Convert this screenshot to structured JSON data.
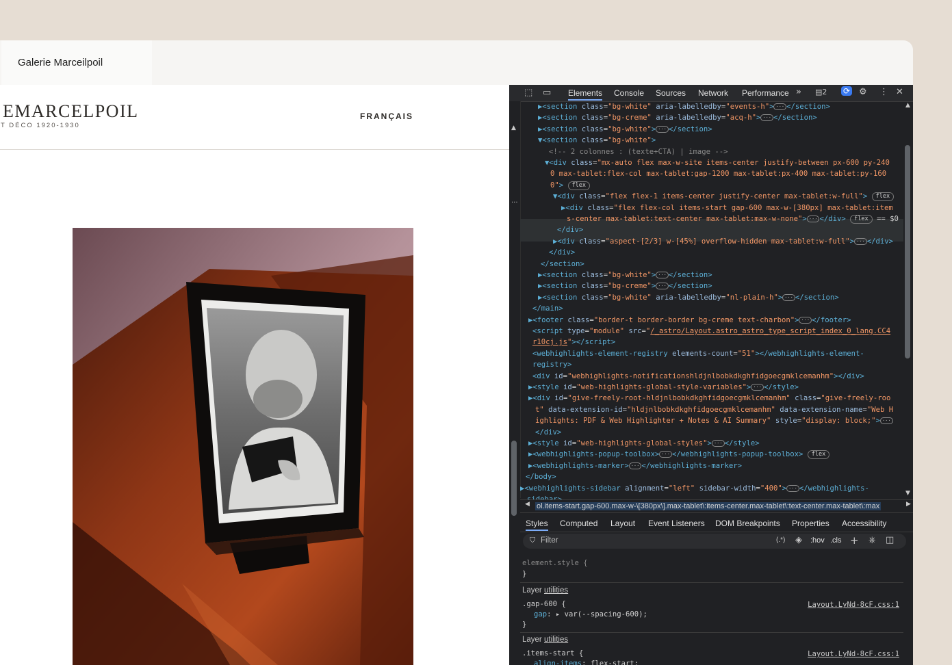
{
  "browser": {
    "tab_title": "Galerie Marceilpoil"
  },
  "site": {
    "logo_text": "EMARCELPOIL",
    "tagline": "T DÉCO 1920-1930",
    "language": "FRANÇAIS"
  },
  "devtools": {
    "tabs": [
      "Elements",
      "Console",
      "Sources",
      "Network",
      "Performance"
    ],
    "issues_count": "2",
    "code_lines": [
      {
        "html": "<span class='tag'>▶&lt;section</span> <span class='attr'>class</span>=<span class='val'>\"bg-white\"</span> <span class='attr'>aria-labelledby</span>=<span class='val'>\"events-h\"</span><span class='tag'>&gt;</span><span class='ell'>···</span><span class='tag'>&lt;/section&gt;</span>",
        "indent": 42
      },
      {
        "html": "<span class='tag'>▶&lt;section</span> <span class='attr'>class</span>=<span class='val'>\"bg-creme\"</span> <span class='attr'>aria-labelledby</span>=<span class='val'>\"acq-h\"</span><span class='tag'>&gt;</span><span class='ell'>···</span><span class='tag'>&lt;/section&gt;</span>",
        "indent": 42
      },
      {
        "html": "<span class='tag'>▶&lt;section</span> <span class='attr'>class</span>=<span class='val'>\"bg-white\"</span><span class='tag'>&gt;</span><span class='ell'>···</span><span class='tag'>&lt;/section&gt;</span>",
        "indent": 42
      },
      {
        "html": "<span class='tag'>▼&lt;section</span> <span class='attr'>class</span>=<span class='val'>\"bg-white\"</span><span class='tag'>&gt;</span>",
        "indent": 42
      },
      {
        "html": "<span class='cmt'>&lt;!-- 2 colonnes : (texte+CTA) | image --&gt;</span>",
        "indent": 58
      },
      {
        "html": "<span class='tag'>▼&lt;div</span> <span class='attr'>class</span>=<span class='val'>\"mx-auto flex max-w-site items-center justify-between px-600 py-240</span>",
        "indent": 52
      },
      {
        "html": "<span class='val'>0 max-tablet:flex-col max-tablet:gap-1200 max-tablet:px-400 max-tablet:py-160</span>",
        "indent": 60
      },
      {
        "html": "<span class='val'>0\"</span><span class='tag'>&gt;</span> <span class='pill'>flex</span>",
        "indent": 60
      },
      {
        "html": "<span class='tag'>▼&lt;div</span> <span class='attr'>class</span>=<span class='val'>\"flex flex-1 items-center justify-center max-tablet:w-full\"</span><span class='tag'>&gt;</span> <span class='pill'>flex</span>",
        "indent": 64
      },
      {
        "html": "<span class='tag'>▶&lt;div</span> <span class='attr'>class</span>=<span class='val'>\"flex flex-col items-start gap-600 max-w-[380px] max-tablet:item</span>",
        "indent": 76
      },
      {
        "html": "<span class='val'>s-center max-tablet:text-center max-tablet:max-w-none\"</span><span class='tag'>&gt;</span><span class='ell'>···</span><span class='tag'>&lt;/div&gt;</span> <span class='pill'>flex</span> <span class='txt'>== $0</span>",
        "indent": 84
      },
      {
        "html": "<span class='tag'>&lt;/div&gt;</span>",
        "indent": 70
      },
      {
        "html": "<span class='tag'>▶&lt;div</span> <span class='attr'>class</span>=<span class='val'>\"aspect-[2/3] w-[45%] overflow-hidden max-tablet:w-full\"</span><span class='tag'>&gt;</span><span class='ell'>···</span><span class='tag'>&lt;/div&gt;</span>",
        "indent": 64
      },
      {
        "html": "<span class='tag'>&lt;/div&gt;</span>",
        "indent": 58
      },
      {
        "html": "<span class='tag'>&lt;/section&gt;</span>",
        "indent": 46
      },
      {
        "html": "<span class='tag'>▶&lt;section</span> <span class='attr'>class</span>=<span class='val'>\"bg-white\"</span><span class='tag'>&gt;</span><span class='ell'>···</span><span class='tag'>&lt;/section&gt;</span>",
        "indent": 42
      },
      {
        "html": "<span class='tag'>▶&lt;section</span> <span class='attr'>class</span>=<span class='val'>\"bg-creme\"</span><span class='tag'>&gt;</span><span class='ell'>···</span><span class='tag'>&lt;/section&gt;</span>",
        "indent": 42
      },
      {
        "html": "<span class='tag'>▶&lt;section</span> <span class='attr'>class</span>=<span class='val'>\"bg-white\"</span> <span class='attr'>aria-labelledby</span>=<span class='val'>\"nl-plain-h\"</span><span class='tag'>&gt;</span><span class='ell'>···</span><span class='tag'>&lt;/section&gt;</span>",
        "indent": 42
      },
      {
        "html": "<span class='tag'>&lt;/main&gt;</span>",
        "indent": 34
      },
      {
        "html": "<span class='tag'>▶&lt;footer</span> <span class='attr'>class</span>=<span class='val'>\"border-t border-border bg-creme text-charbon\"</span><span class='tag'>&gt;</span><span class='ell'>···</span><span class='tag'>&lt;/footer&gt;</span>",
        "indent": 28
      },
      {
        "html": "<span class='tag'>&lt;script</span> <span class='attr'>type</span>=<span class='val'>\"module\"</span> <span class='attr'>src</span>=<span class='val'>\"<u>/_astro/Layout.astro_astro_type_script_index_0_lang.CC4</u></span>",
        "indent": 34
      },
      {
        "html": "<span class='val'><u>r10cj.js</u>\"</span><span class='tag'>&gt;&lt;/script&gt;</span>",
        "indent": 34
      },
      {
        "html": "<span class='tag'>&lt;webhighlights-element-registry</span> <span class='attr'>elements-count</span>=<span class='val'>\"51\"</span><span class='tag'>&gt;&lt;/webhighlights-element-</span>",
        "indent": 34
      },
      {
        "html": "<span class='tag'>registry&gt;</span>",
        "indent": 34
      },
      {
        "html": "<span class='tag'>&lt;div</span> <span class='attr'>id</span>=<span class='val'>\"webhighlights-notificationshldjnlbobkdkghfidgoecgmklcemanhm\"</span><span class='tag'>&gt;&lt;/div&gt;</span>",
        "indent": 34
      },
      {
        "html": "<span class='tag'>▶&lt;style</span> <span class='attr'>id</span>=<span class='val'>\"web-highlights-global-style-variables\"</span><span class='tag'>&gt;</span><span class='ell'>···</span><span class='tag'>&lt;/style&gt;</span>",
        "indent": 28
      },
      {
        "html": "<span class='tag'>▶&lt;div</span> <span class='attr'>id</span>=<span class='val'>\"give-freely-root-hldjnlbobkdkghfidgoecgmklcemanhm\"</span> <span class='attr'>class</span>=<span class='val'>\"give-freely-roo</span>",
        "indent": 28
      },
      {
        "html": "<span class='val'>t\"</span> <span class='attr'>data-extension-id</span>=<span class='val'>\"hldjnlbobkdkghfidgoecgmklcemanhm\"</span> <span class='attr'>data-extension-name</span>=<span class='val'>\"Web H</span>",
        "indent": 38
      },
      {
        "html": "<span class='val'>ighlights: PDF &amp; Web Highlighter + Notes &amp; AI Summary\"</span> <span class='attr'>style</span>=<span class='val'>\"display: block;\"</span><span class='tag'>&gt;</span><span class='ell'>···</span>",
        "indent": 38
      },
      {
        "html": "<span class='tag'>&lt;/div&gt;</span>",
        "indent": 38
      },
      {
        "html": "<span class='tag'>▶&lt;style</span> <span class='attr'>id</span>=<span class='val'>\"web-highlights-global-styles\"</span><span class='tag'>&gt;</span><span class='ell'>···</span><span class='tag'>&lt;/style&gt;</span>",
        "indent": 28
      },
      {
        "html": "<span class='tag'>▶&lt;webhighlights-popup-toolbox&gt;</span><span class='ell'>···</span><span class='tag'>&lt;/webhighlights-popup-toolbox&gt;</span> <span class='pill'>flex</span>",
        "indent": 28
      },
      {
        "html": "<span class='tag'>▶&lt;webhighlights-marker&gt;</span><span class='ell'>···</span><span class='tag'>&lt;/webhighlights-marker&gt;</span>",
        "indent": 28
      },
      {
        "html": "<span class='tag'>&lt;/body&gt;</span>",
        "indent": 24
      },
      {
        "html": "<span class='tag'>▶&lt;webhighlights-sidebar</span> <span class='attr'>alignment</span>=<span class='val'>\"left\"</span> <span class='attr'>sidebar-width</span>=<span class='val'>\"400\"</span><span class='tag'>&gt;</span><span class='ell'>···</span><span class='tag'>&lt;/webhighlights-</span>",
        "indent": 16
      },
      {
        "html": "<span class='tag'>sidebar&gt;</span>",
        "indent": 26
      }
    ],
    "breadcrumb": "ol.items-start.gap-600.max-w-\\[380px\\].max-tablet\\:items-center.max-tablet\\:text-center.max-tablet\\:max",
    "styles_tabs": [
      "Styles",
      "Computed",
      "Layout",
      "Event Listeners",
      "DOM Breakpoints",
      "Properties",
      "Accessibility"
    ],
    "filter_placeholder": "Filter",
    "filter_tools": {
      "regex": "(.*)",
      "hov": ":hov",
      "cls": ".cls"
    },
    "element_style": "element.style {",
    "element_style_close": "}",
    "layer_label": "Layer",
    "layer_name": "utilities",
    "rules": [
      {
        "selector": ".gap-600 {",
        "property": "gap",
        "value": "var(--spacing-600);",
        "source": "Layout.LyNd-8cF.css:1"
      },
      {
        "selector": ".items-start {",
        "property": "align-items",
        "value": "flex-start;",
        "source": "Layout.LyNd-8cF.css:1"
      }
    ]
  }
}
